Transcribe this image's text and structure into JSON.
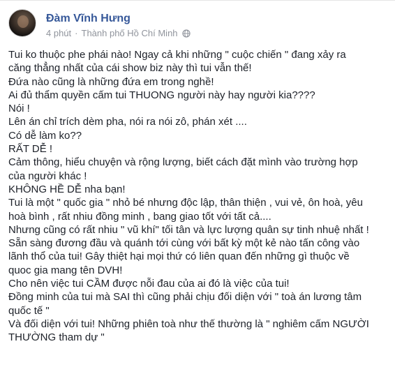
{
  "post": {
    "author": "Đàm Vĩnh Hưng",
    "time": "4 phút",
    "separator": "·",
    "location": "Thành phố Hồ Chí Minh",
    "privacy_icon": "globe-icon",
    "lines": [
      "Tui ko thuộc phe phái nào! Ngay cả khi những \" cuộc chiến \" đang xảy ra",
      "căng thẳng nhất của cái show biz này thì tui vẫn thế!",
      "Đứa nào cũng là những đứa em trong nghề!",
      "Ai đủ thẩm quyền cấm tui THUONG người này hay người kia????",
      "Nói !",
      "Lên án chỉ trích dèm pha, nói ra nói zô, phán xét ....",
      "Có dễ làm ko??",
      "RẤT DỄ !",
      "Cảm thông, hiểu chuyện và rộng lượng, biết cách đặt mình vào trường hợp",
      "của người khác !",
      "KHÔNG HỀ DỄ nha bạn!",
      "Tui là một \" quốc gia \" nhỏ bé nhưng độc lập, thân thiện , vui vẻ, ôn hoà, yêu",
      "hoà bình , rất nhiu đồng minh , bang giao tốt với tất cả....",
      "Nhưng cũng có rất nhiu \" vũ khí\" tối tân và lực lượng quân sự tinh nhuệ nhất !",
      "Sẵn sàng đương đầu và quánh tới cùng với bất kỳ một kẻ nào tấn công vào",
      "lãnh thổ của tui! Gây thiệt hại mọi thứ có liên quan đến những gì thuộc về",
      "quoc gia mang tên DVH!",
      "Cho nên việc tui CẦM được nỗi đau của ai đó là việc của tui!",
      "Đồng minh của tui mà SAI thì cũng phải chịu đối diện với \" toà án lương tâm",
      "quốc tế \"",
      "Và đối diện với tui! Những phiên toà như thế thường là \" nghiêm cấm NGƯỜI",
      "THƯỜNG tham dự \""
    ]
  }
}
